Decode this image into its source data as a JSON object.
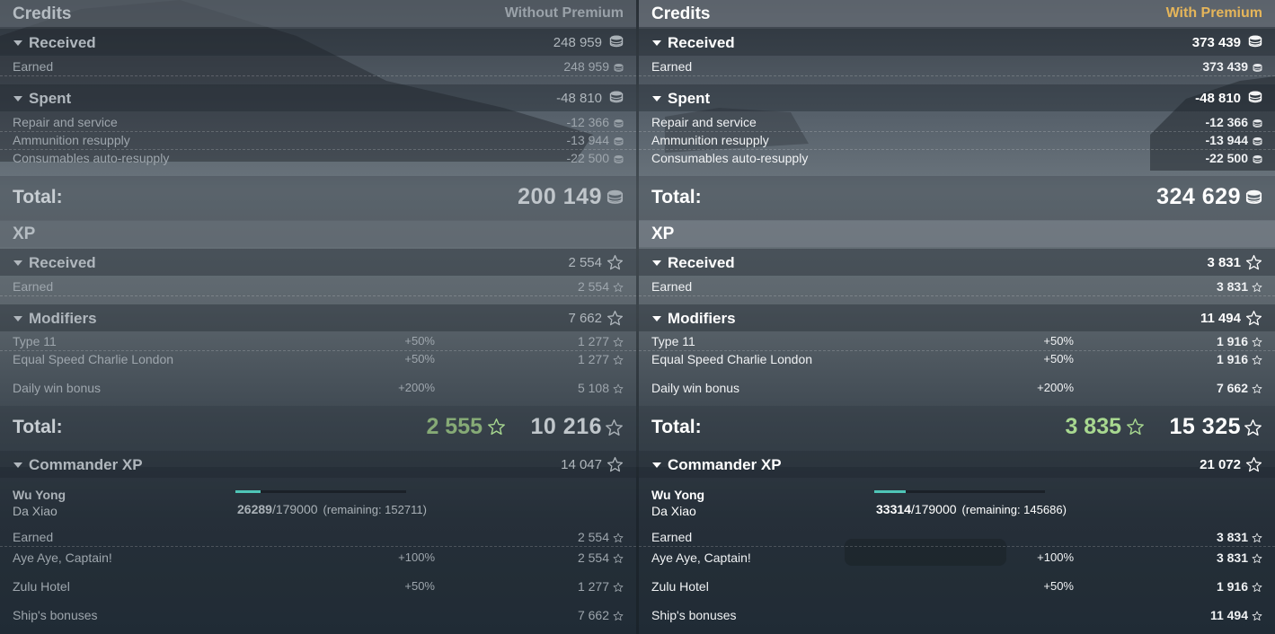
{
  "left": {
    "credits": {
      "title": "Credits",
      "mode": "Without Premium",
      "received": {
        "label": "Received",
        "value": "248 959"
      },
      "earned": {
        "label": "Earned",
        "value": "248 959"
      },
      "spent": {
        "label": "Spent",
        "value": "-48 810"
      },
      "repair": {
        "label": "Repair and service",
        "value": "-12 366"
      },
      "ammo": {
        "label": "Ammunition resupply",
        "value": "-13 944"
      },
      "consumables": {
        "label": "Consumables auto-resupply",
        "value": "-22 500"
      },
      "total": {
        "label": "Total:",
        "value": "200 149"
      }
    },
    "xp": {
      "title": "XP",
      "received": {
        "label": "Received",
        "value": "2 554"
      },
      "earned": {
        "label": "Earned",
        "value": "2 554"
      },
      "modifiers": {
        "label": "Modifiers",
        "value": "7 662"
      },
      "type11": {
        "label": "Type 11",
        "pct": "+50%",
        "value": "1 277"
      },
      "equal": {
        "label": "Equal Speed Charlie London",
        "pct": "+50%",
        "value": "1 277"
      },
      "daily": {
        "label": "Daily win bonus",
        "pct": "+200%",
        "value": "5 108"
      },
      "total": {
        "label": "Total:",
        "base": "2 555",
        "value": "10 216"
      }
    },
    "commander": {
      "header": {
        "label": "Commander XP",
        "value": "14 047"
      },
      "name": "Wu Yong",
      "ship": "Da Xiao",
      "progress_fraction": 0.1469,
      "current": "26289",
      "max": "/179000",
      "remaining": "(remaining: 152711)",
      "earned": {
        "label": "Earned",
        "value": "2 554"
      },
      "aye": {
        "label": "Aye Aye, Captain!",
        "pct": "+100%",
        "value": "2 554"
      },
      "zulu": {
        "label": "Zulu Hotel",
        "pct": "+50%",
        "value": "1 277"
      },
      "ship_bonus": {
        "label": "Ship's bonuses",
        "value": "7 662"
      }
    }
  },
  "right": {
    "credits": {
      "title": "Credits",
      "mode": "With Premium",
      "received": {
        "label": "Received",
        "value": "373 439"
      },
      "earned": {
        "label": "Earned",
        "value": "373 439"
      },
      "spent": {
        "label": "Spent",
        "value": "-48 810"
      },
      "repair": {
        "label": "Repair and service",
        "value": "-12 366"
      },
      "ammo": {
        "label": "Ammunition resupply",
        "value": "-13 944"
      },
      "consumables": {
        "label": "Consumables auto-resupply",
        "value": "-22 500"
      },
      "total": {
        "label": "Total:",
        "value": "324 629"
      }
    },
    "xp": {
      "title": "XP",
      "received": {
        "label": "Received",
        "value": "3 831"
      },
      "earned": {
        "label": "Earned",
        "value": "3 831"
      },
      "modifiers": {
        "label": "Modifiers",
        "value": "11 494"
      },
      "type11": {
        "label": "Type 11",
        "pct": "+50%",
        "value": "1 916"
      },
      "equal": {
        "label": "Equal Speed Charlie London",
        "pct": "+50%",
        "value": "1 916"
      },
      "daily": {
        "label": "Daily win bonus",
        "pct": "+200%",
        "value": "7 662"
      },
      "total": {
        "label": "Total:",
        "base": "3 835",
        "value": "15 325"
      }
    },
    "commander": {
      "header": {
        "label": "Commander XP",
        "value": "21 072"
      },
      "name": "Wu Yong",
      "ship": "Da Xiao",
      "progress_fraction": 0.1861,
      "current": "33314",
      "max": "/179000",
      "remaining": "(remaining: 145686)",
      "earned": {
        "label": "Earned",
        "value": "3 831"
      },
      "aye": {
        "label": "Aye Aye, Captain!",
        "pct": "+100%",
        "value": "3 831"
      },
      "zulu": {
        "label": "Zulu Hotel",
        "pct": "+50%",
        "value": "1 916"
      },
      "ship_bonus": {
        "label": "Ship's bonuses",
        "value": "11 494"
      }
    }
  },
  "icons": {
    "credits": "coin-stack-icon",
    "xp": "star-icon",
    "expand": "triangle-down-icon"
  },
  "colors": {
    "premium": "#e5b55a",
    "base_xp": "#a8d890",
    "progress": "#4fc5b7"
  }
}
